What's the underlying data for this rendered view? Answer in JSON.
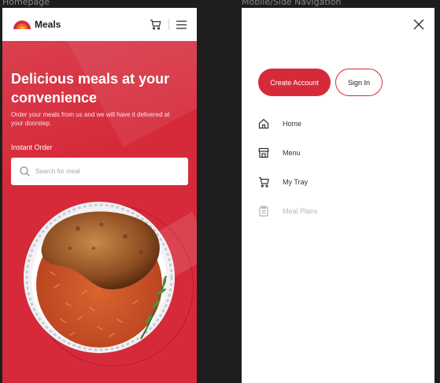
{
  "frames": {
    "home_label": "Homepage",
    "nav_label": "Mobile/Side Navigation"
  },
  "home": {
    "logo_text": "Meals",
    "hero_title": "Delicious meals at your convenience",
    "hero_subtitle": "Order your meals from us and we will have it delivered at your doorstep.",
    "instant_order_label": "Instant Order",
    "search_placeholder": "Search for meal",
    "brand_color": "#d62a3a"
  },
  "sidenav": {
    "create_account_label": "Create Account",
    "sign_in_label": "Sign In",
    "items": [
      {
        "label": "Home",
        "icon": "home-icon",
        "enabled": true
      },
      {
        "label": "Menu",
        "icon": "store-icon",
        "enabled": true
      },
      {
        "label": "My Tray",
        "icon": "cart-icon",
        "enabled": true
      },
      {
        "label": "Meal Plans",
        "icon": "clipboard-icon",
        "enabled": false
      }
    ]
  }
}
